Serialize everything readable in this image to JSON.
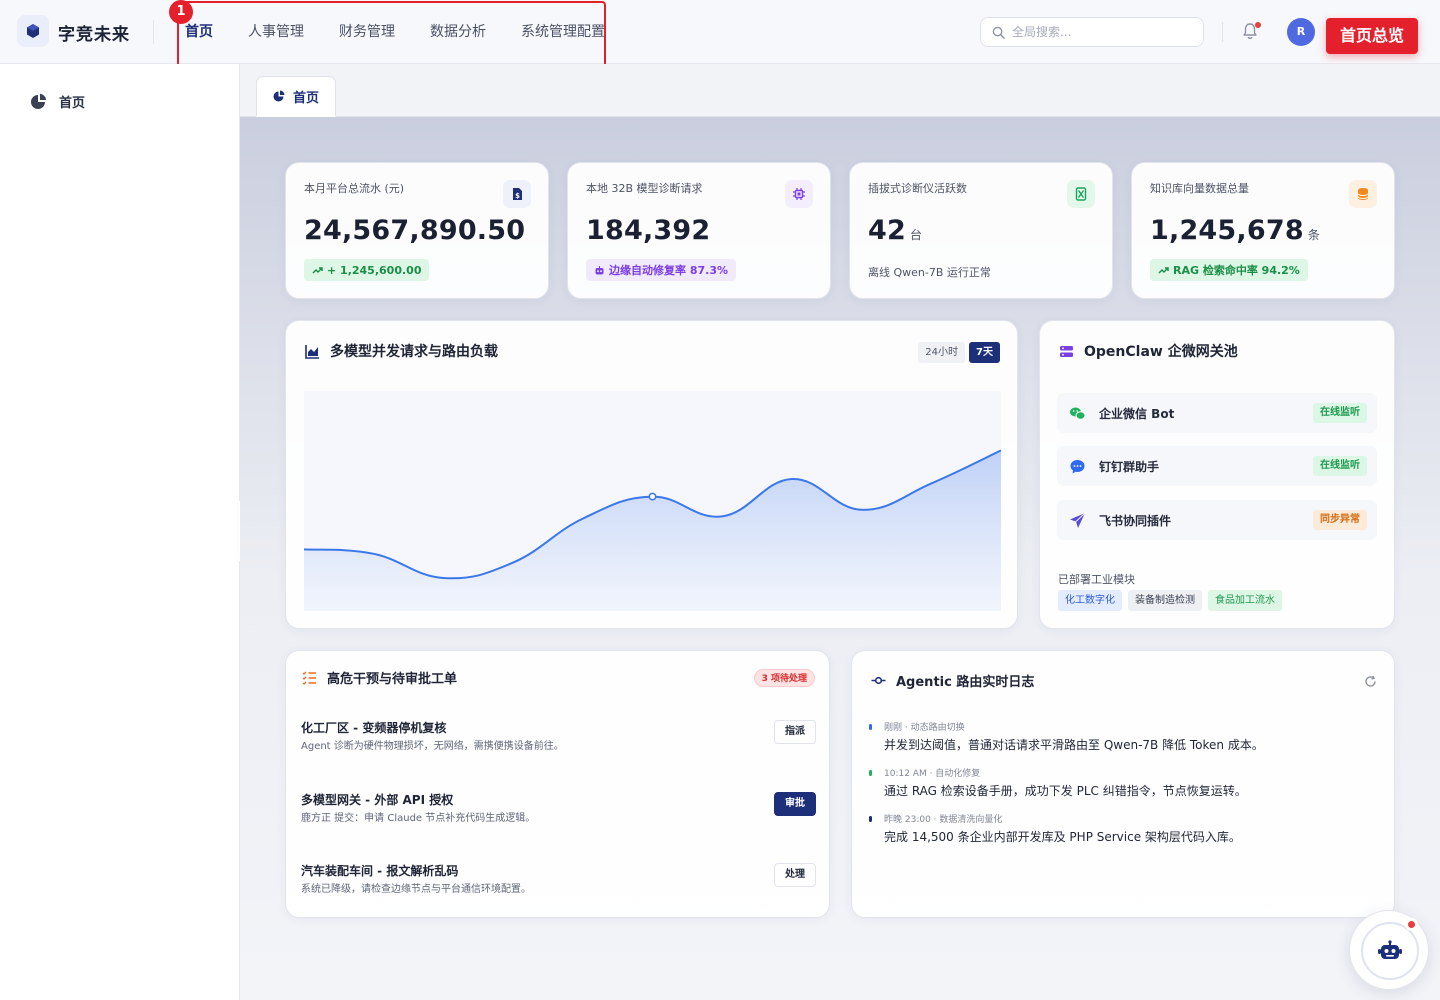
{
  "header": {
    "brand": "字竞未来",
    "nav": [
      "首页",
      "人事管理",
      "财务管理",
      "数据分析",
      "系统管理配置"
    ],
    "nav_active_index": 0,
    "highlight_badge": "1",
    "search_placeholder": "全局搜索...",
    "avatar_initial": "R",
    "page_tag": "首页总览"
  },
  "sidebar": {
    "items": [
      {
        "label": "首页",
        "icon": "pie-chart-icon"
      }
    ]
  },
  "tabs": [
    {
      "label": "首页",
      "icon": "pie-chart-icon"
    }
  ],
  "stats": [
    {
      "title": "本月平台总流水 (元)",
      "value": "24,567,890.50",
      "unit": "",
      "badge": "+ 1,245,600.00",
      "badge_icon": "trend-up-icon",
      "icon": "invoice-dollar-icon",
      "color": "#1e2f7a"
    },
    {
      "title": "本地 32B 模型诊断请求",
      "value": "184,392",
      "unit": "",
      "badge": "边缘自动修复率 87.3%",
      "badge_icon": "robot-icon",
      "icon": "chip-icon",
      "color": "#7b3fe4"
    },
    {
      "title": "插拔式诊断仪活跃数",
      "value": "42",
      "unit": "台",
      "note": "离线 Qwen-7B 运行正常",
      "icon": "hourglass-icon",
      "color": "#19a35a"
    },
    {
      "title": "知识库向量数据总量",
      "value": "1,245,678",
      "unit": "条",
      "badge": "RAG 检索命中率 94.2%",
      "badge_icon": "trend-up-icon",
      "icon": "database-icon",
      "color": "#f08a1c"
    }
  ],
  "chart_card": {
    "title": "多模型并发请求与路由负载",
    "ranges": [
      "24小时",
      "7天"
    ],
    "active_range": "7天"
  },
  "chart_data": {
    "type": "area",
    "x": [
      0,
      1,
      2,
      3,
      4,
      5,
      6,
      7,
      8,
      9,
      10
    ],
    "values": [
      0.28,
      0.26,
      0.15,
      0.22,
      0.42,
      0.52,
      0.43,
      0.6,
      0.46,
      0.58,
      0.73
    ],
    "highlight_index": 5,
    "title": "",
    "xlabel": "",
    "ylabel": "",
    "ylim": [
      0,
      1
    ]
  },
  "gateway": {
    "title": "OpenClaw 企微网关池",
    "items": [
      {
        "name": "企业微信 Bot",
        "status": "在线监听",
        "state": "ok",
        "icon": "wechat-icon"
      },
      {
        "name": "钉钉群助手",
        "status": "在线监听",
        "state": "ok",
        "icon": "chat-bubble-icon"
      },
      {
        "name": "飞书协同插件",
        "status": "同步异常",
        "state": "warn",
        "icon": "paper-plane-icon"
      }
    ],
    "modules_label": "已部署工业模块",
    "modules": [
      {
        "label": "化工数字化",
        "bg": "#e4ecff",
        "fg": "#2b5bd7"
      },
      {
        "label": "装备制造检测",
        "bg": "#eef0f4",
        "fg": "#3a4152"
      },
      {
        "label": "食品加工流水",
        "bg": "#def6e6",
        "fg": "#1f9a4f"
      }
    ]
  },
  "tasks": {
    "title": "高危干预与待审批工单",
    "badge": "3 项待处理",
    "items": [
      {
        "title": "化工厂区 - 变频器停机复核",
        "desc": "Agent 诊断为硬件物理损坏，无网络，需携便携设备前往。",
        "action": "指派",
        "primary": false
      },
      {
        "title": "多模型网关 - 外部 API 授权",
        "desc": "鹿方正 提交：申请 Claude 节点补充代码生成逻辑。",
        "action": "审批",
        "primary": true
      },
      {
        "title": "汽车装配车间 - 报文解析乱码",
        "desc": "系统已降级，请检查边缘节点与平台通信环境配置。",
        "action": "处理",
        "primary": false
      }
    ]
  },
  "logs": {
    "title": "Agentic 路由实时日志",
    "items": [
      {
        "meta": "刚刚 · 动态路由切换",
        "text": "并发到达阈值，普通对话请求平滑路由至 Qwen-7B 降低 Token 成本。",
        "color": "#2f6bf0"
      },
      {
        "meta": "10:12 AM · 自动化修复",
        "text": "通过 RAG 检索设备手册，成功下发 PLC 纠错指令，节点恢复运转。",
        "color": "#1fb15d"
      },
      {
        "meta": "昨晚 23:00 · 数据清洗向量化",
        "text": "完成 14,500 条企业内部开发库及 PHP Service 架构层代码入库。",
        "color": "#1e2f7a"
      }
    ]
  }
}
